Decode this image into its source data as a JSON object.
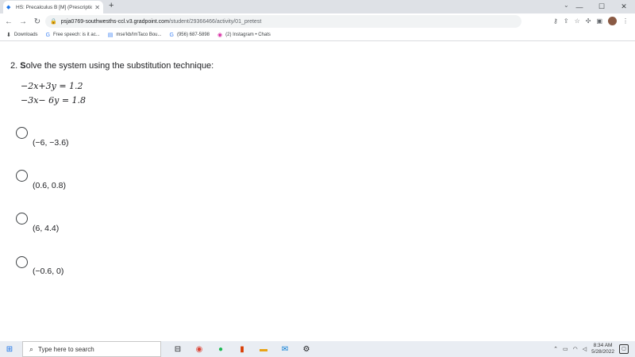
{
  "browser": {
    "tab_title": "HS: Precalculus B [M] (Prescriptio",
    "tab_close": "✕",
    "new_tab": "+",
    "window_controls": {
      "minimize": "—",
      "maximize": "☐",
      "close": "✕",
      "tab_search": "⌄"
    },
    "url_host": "psja0769-southwesths-ccl.v3.gradpoint.com",
    "url_path": "/student/29366466/activity/01_pretest",
    "bookmarks": [
      {
        "icon": "⬇",
        "label": "Downloads"
      },
      {
        "icon": "G",
        "label": "Free speech: is it ac..."
      },
      {
        "icon": "▤",
        "label": "mse'kb/ImTaco Bou..."
      },
      {
        "icon": "G",
        "label": "(956) 687-5898"
      },
      {
        "icon": "◉",
        "label": "(2) Instagram • Chats"
      }
    ]
  },
  "question": {
    "number": "2.",
    "first_letter": "S",
    "text": "olve the system using the substitution technique:",
    "equations": [
      "−2x+3y = 1.2",
      "−3x− 6y = 1.8"
    ],
    "choices": [
      "(−6, −3.6)",
      "(0.6, 0.8)",
      "(6, 4.4)",
      "(−0.6, 0)"
    ]
  },
  "taskbar": {
    "search_placeholder": "Type here to search",
    "time": "8:34 AM",
    "date": "5/28/2022",
    "notification_count": "99+"
  }
}
